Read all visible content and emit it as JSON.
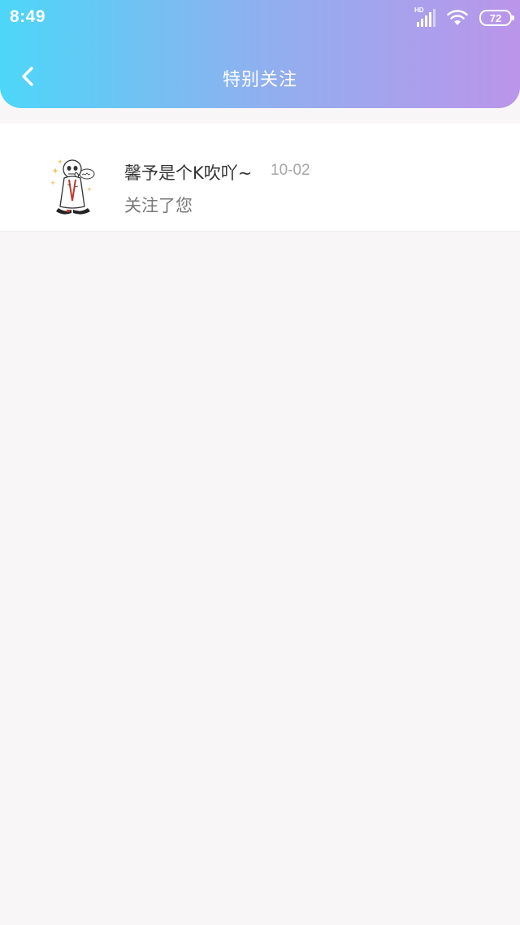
{
  "status_bar": {
    "time": "8:49",
    "network_label": "HD",
    "battery_level": "72",
    "icons": [
      "signal-icon",
      "wifi-icon",
      "battery-icon"
    ]
  },
  "header": {
    "title": "特别关注",
    "back_icon": "chevron-left-icon"
  },
  "colors": {
    "gradient_start": "#4dd6f8",
    "gradient_end": "#bb95ea",
    "background": "#f8f6f7"
  },
  "items": [
    {
      "name": "馨予是个K吹吖~",
      "date": "10-02",
      "message": "关注了您",
      "avatar": "cartoon-skeleton-avatar"
    }
  ]
}
